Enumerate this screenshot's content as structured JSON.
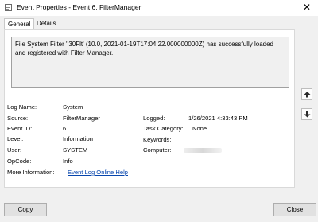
{
  "window": {
    "title": "Event Properties - Event 6, FilterManager",
    "close_glyph": "✕"
  },
  "tabs": [
    {
      "label": "General",
      "selected": true
    },
    {
      "label": "Details",
      "selected": false
    }
  ],
  "description": "File System Filter 'i30Flt' (10.0, 2021-01-19T17:04:22.000000000Z) has successfully loaded and registered with Filter Manager.",
  "fields": {
    "log_name": {
      "label": "Log Name:",
      "value": "System"
    },
    "source": {
      "label": "Source:",
      "value": "FilterManager"
    },
    "event_id": {
      "label": "Event ID:",
      "value": "6"
    },
    "level": {
      "label": "Level:",
      "value": "Information"
    },
    "user": {
      "label": "User:",
      "value": "SYSTEM"
    },
    "opcode": {
      "label": "OpCode:",
      "value": "Info"
    },
    "more_info": {
      "label": "More Information:",
      "value": "Event Log Online Help"
    },
    "logged": {
      "label": "Logged:",
      "value": "1/26/2021 4:33:43 PM"
    },
    "task_category": {
      "label": "Task Category:",
      "value": "None"
    },
    "keywords": {
      "label": "Keywords:",
      "value": ""
    },
    "computer": {
      "label": "Computer:",
      "value": ""
    }
  },
  "buttons": {
    "copy": "Copy",
    "close": "Close"
  },
  "icons": {
    "app": "event-viewer-icon",
    "scroll_up": "arrow-up-icon",
    "scroll_down": "arrow-down-icon"
  },
  "colors": {
    "link": "#0645ad",
    "panel": "#ffffff",
    "window": "#f0f0f0"
  }
}
